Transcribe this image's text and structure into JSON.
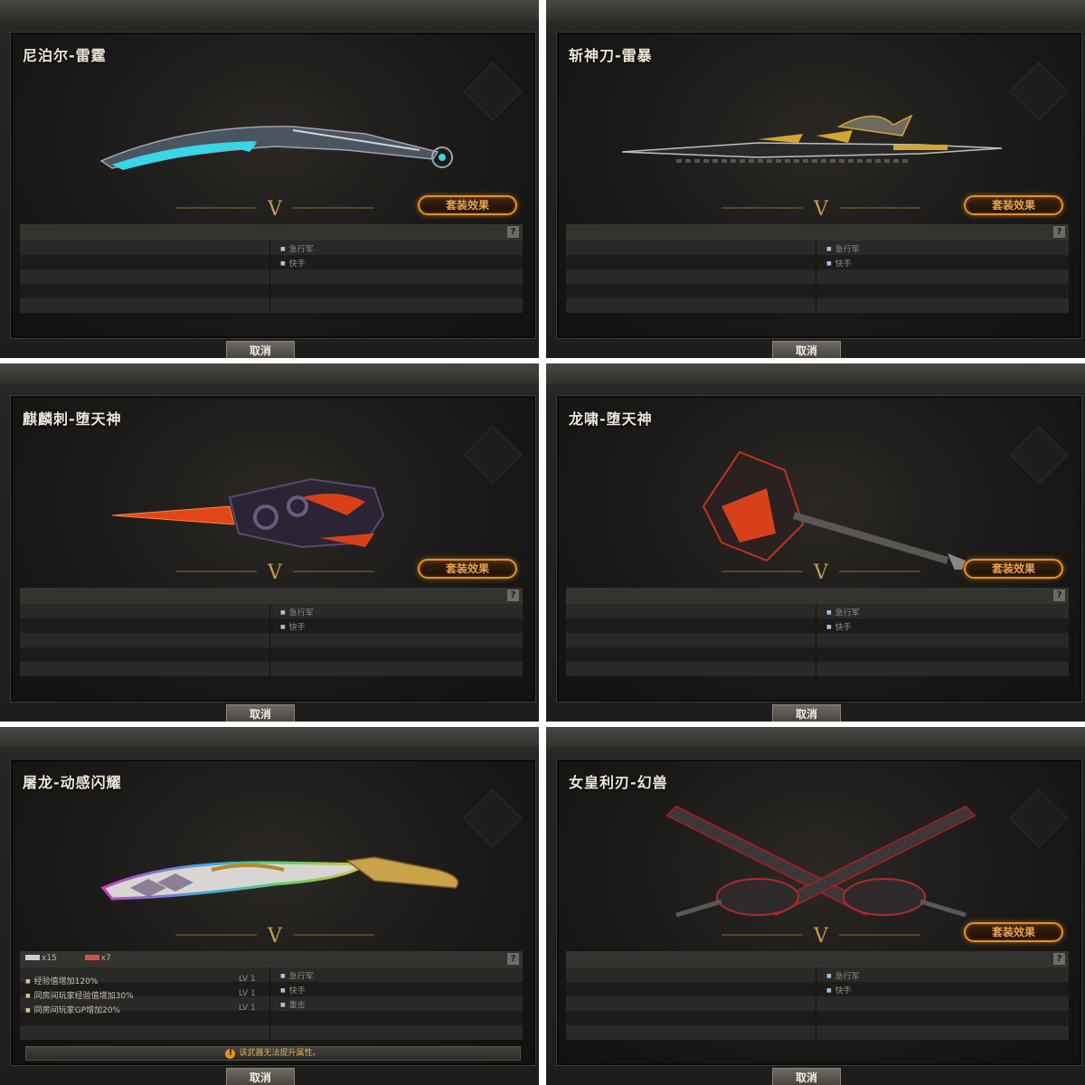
{
  "panels": [
    {
      "title": "尼泊尔-雷霆",
      "effect_label": "套装效果",
      "tags": [
        "急行军",
        "快手"
      ],
      "cancel_label": "取消"
    },
    {
      "title": "斩神刀-雷暴",
      "effect_label": "套装效果",
      "tags": [
        "急行军",
        "快手"
      ],
      "cancel_label": "取消"
    },
    {
      "title": "麒麟刺-堕天神",
      "effect_label": "套装效果",
      "tags": [
        "急行军",
        "快手"
      ],
      "cancel_label": "取消"
    },
    {
      "title": "龙啸-堕天神",
      "effect_label": "套装效果",
      "tags": [
        "急行军",
        "快手"
      ],
      "cancel_label": "取消"
    },
    {
      "title": "屠龙-动感闪耀",
      "tags": [
        "急行军",
        "快手",
        "重击"
      ],
      "cancel_label": "取消",
      "materials": [
        "x15",
        "x7"
      ],
      "stats": [
        {
          "text": "经验值增加120%",
          "level": "LV 1"
        },
        {
          "text": "同房间玩家经验值增加30%",
          "level": "LV 1"
        },
        {
          "text": "同房间玩家GP增加20%",
          "level": "LV 1"
        }
      ],
      "warning": "该武器无法提升属性。"
    },
    {
      "title": "女皇利刃-幻兽",
      "effect_label": "套装效果",
      "tags": [
        "急行军",
        "快手"
      ],
      "cancel_label": "取消"
    }
  ],
  "help_label": "?",
  "badge_letter": "V",
  "colors": {
    "accent_orange": "#e8901e",
    "tag_bullet": "#a5c2e0",
    "title_text": "#efe8d8"
  },
  "icons": [
    "help-icon",
    "warning-icon",
    "v-emblem-icon"
  ]
}
